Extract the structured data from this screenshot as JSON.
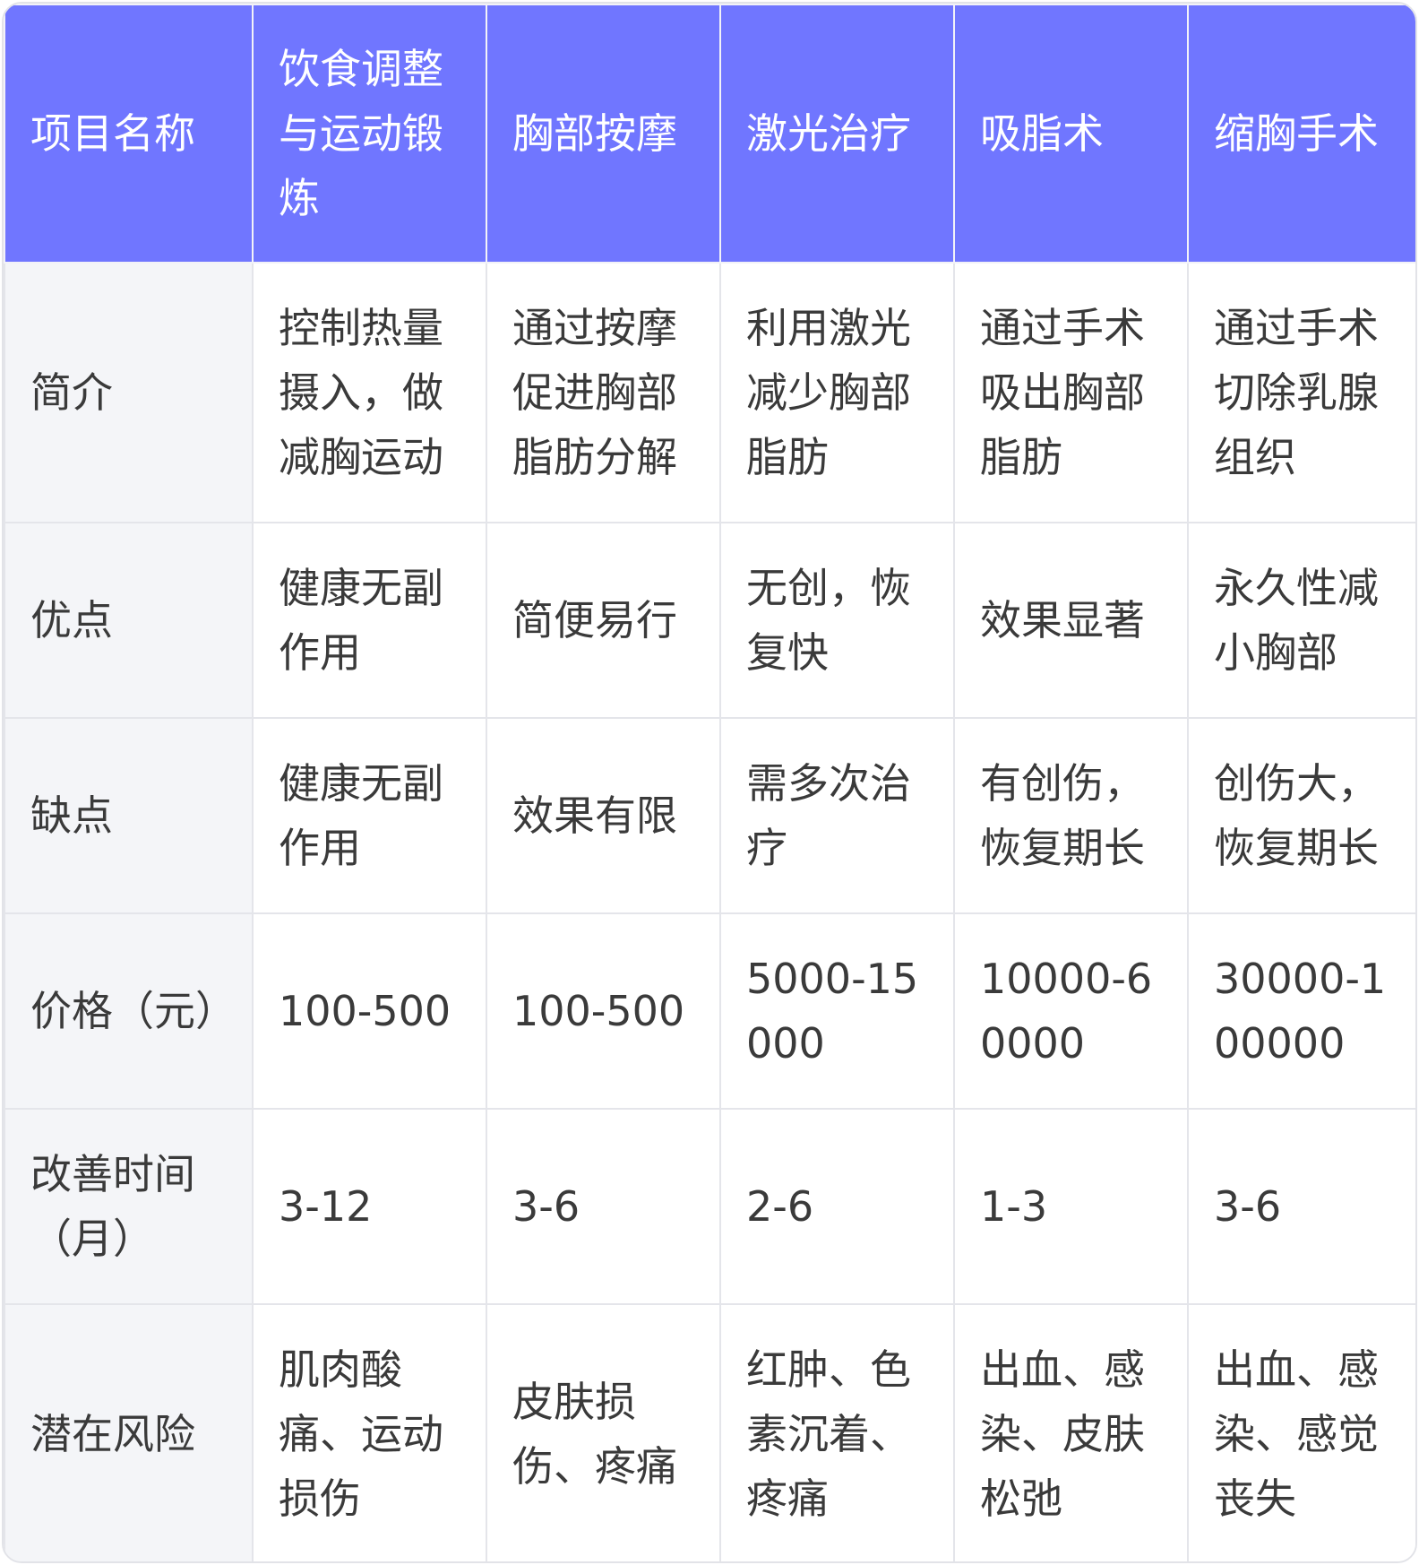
{
  "table": {
    "headers": [
      "项目名称",
      "饮食调整与运动锻炼",
      "胸部按摩",
      "激光治疗",
      "吸脂术",
      "缩胸手术"
    ],
    "rows": [
      {
        "label": "简介",
        "cells": [
          "控制热量摄入，做减胸运动",
          "通过按摩促进胸部脂肪分解",
          "利用激光减少胸部脂肪",
          "通过手术吸出胸部脂肪",
          "通过手术切除乳腺组织"
        ]
      },
      {
        "label": "优点",
        "cells": [
          "健康无副作用",
          "简便易行",
          "无创，恢复快",
          "效果显著",
          "永久性减小胸部"
        ]
      },
      {
        "label": "缺点",
        "cells": [
          "健康无副作用",
          "效果有限",
          "需多次治疗",
          "有创伤，恢复期长",
          "创伤大，恢复期长"
        ]
      },
      {
        "label": "价格（元）",
        "cells": [
          "100-500",
          "100-500",
          "5000-15000",
          "10000-60000",
          "30000-100000"
        ]
      },
      {
        "label": "改善时间（月）",
        "cells": [
          "3-12",
          "3-6",
          "2-6",
          "1-3",
          "3-6"
        ]
      },
      {
        "label": "潜在风险",
        "cells": [
          "肌肉酸痛、运动损伤",
          "皮肤损伤、疼痛",
          "红肿、色素沉着、疼痛",
          "出血、感染、皮肤松弛",
          "出血、感染、感觉丧失"
        ]
      }
    ]
  },
  "colors": {
    "header_bg": "#7076ff",
    "header_text": "#ffffff",
    "row_head_bg": "#f4f5f8",
    "cell_text": "#3a3a3a"
  }
}
